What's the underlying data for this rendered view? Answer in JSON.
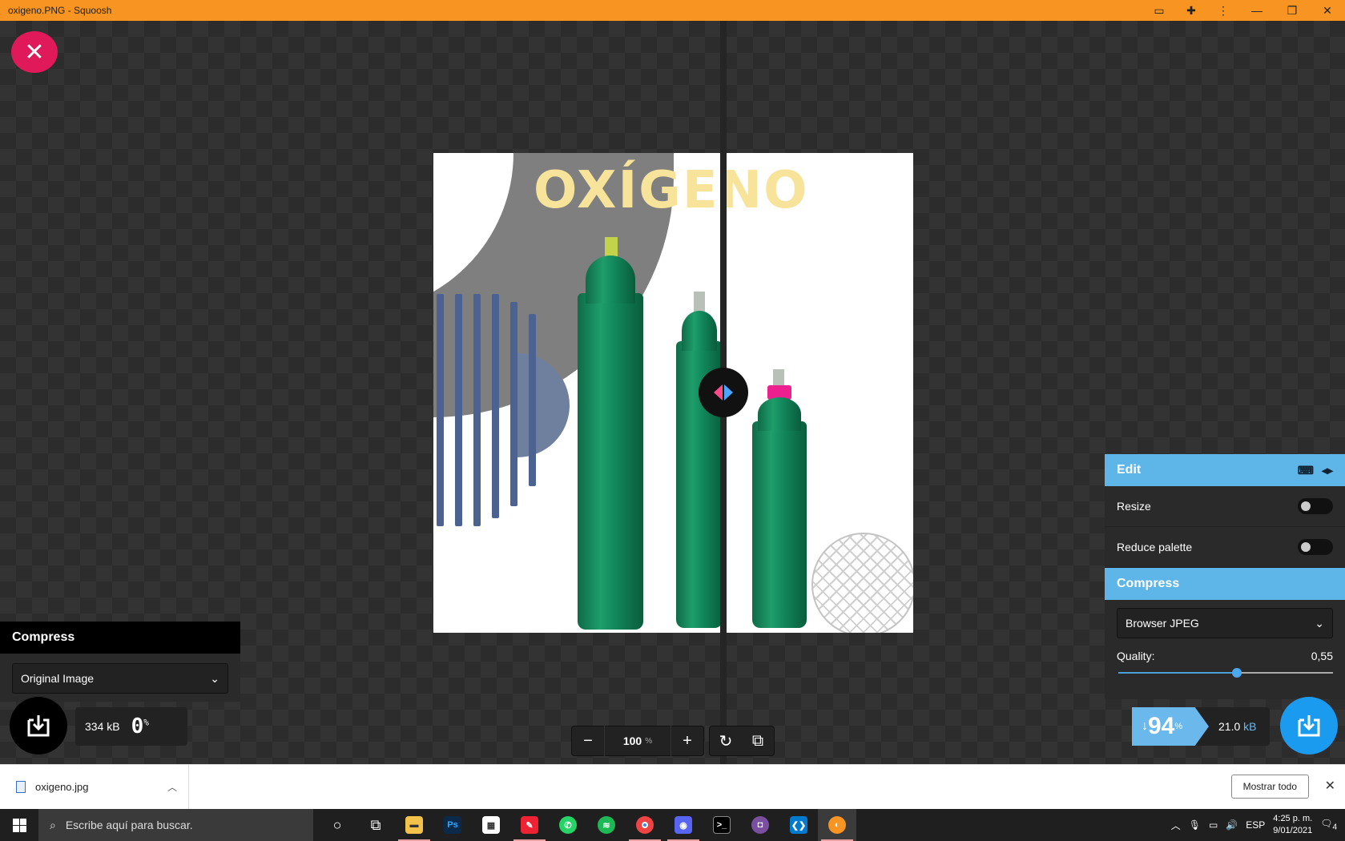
{
  "window": {
    "title": "oxigeno.PNG - Squoosh"
  },
  "titlebar_icons": [
    "clipboard-icon",
    "puzzle-icon",
    "more-vert-icon",
    "minimize-icon",
    "restore-icon",
    "close-icon"
  ],
  "image": {
    "logo_text": "OXÍGENO"
  },
  "left_panel": {
    "title": "Compress",
    "selected": "Original Image",
    "size_value": "334",
    "size_unit": "kB",
    "percent": "0",
    "percent_symbol": "%"
  },
  "zoom": {
    "value": "100",
    "unit": "%",
    "minus": "−",
    "plus": "+"
  },
  "right_panel": {
    "edit_title": "Edit",
    "resize_label": "Resize",
    "resize_on": false,
    "reduce_palette_label": "Reduce palette",
    "reduce_palette_on": false,
    "compress_title": "Compress",
    "selected": "Browser JPEG",
    "quality_label": "Quality:",
    "quality_value": "0,55",
    "reduction_arrow": "↓",
    "reduction_percent": "94",
    "percent_symbol": "%",
    "size_value": "21.0",
    "size_unit": "kB"
  },
  "download_bar": {
    "file_name": "oxigeno.jpg",
    "show_all": "Mostrar todo"
  },
  "taskbar": {
    "search_placeholder": "Escribe aquí para buscar.",
    "apps": [
      "cortana-icon",
      "task-view-icon",
      "file-explorer-icon",
      "photoshop-icon",
      "store-icon",
      "paint-icon",
      "whatsapp-icon",
      "spotify-icon",
      "chrome-icon",
      "app-icon",
      "terminal-icon",
      "app-purple-icon",
      "vscode-icon",
      "squoosh-icon"
    ],
    "language": "ESP",
    "time": "4:25 p. m.",
    "date": "9/01/2021",
    "notifications": "4"
  },
  "colors": {
    "titlebar": "#f79422",
    "close_button": "#e0195b",
    "accent_blue": "#5eb5e8",
    "cylinder_green": "#11855a",
    "pink_cap": "#ee1f8f"
  }
}
